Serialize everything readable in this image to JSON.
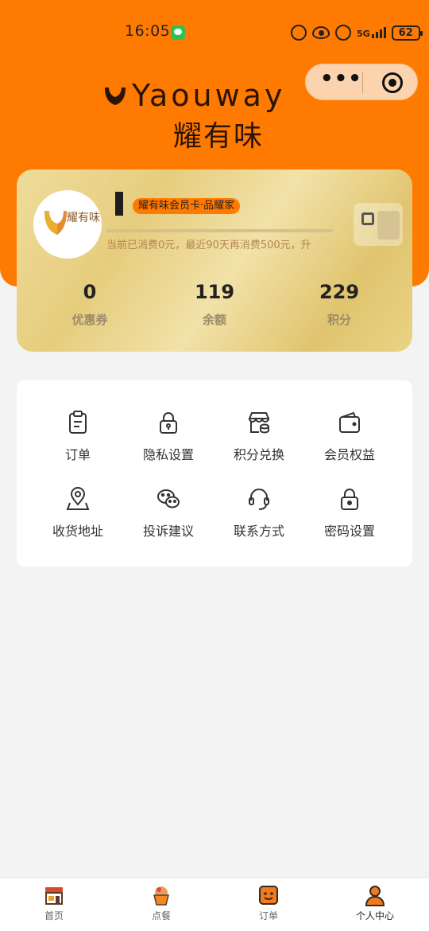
{
  "status_bar": {
    "time": "16:05",
    "network": "5G",
    "battery": "62"
  },
  "capsule": {
    "more_icon": "more-dots-icon",
    "close_icon": "target-icon"
  },
  "brand": {
    "latin_name": "Yaouway",
    "cjk_name": "耀有味"
  },
  "member_card": {
    "avatar_text": "耀有味",
    "badge": "耀有味会员卡·品耀家",
    "progress_fraction": 0.0,
    "progress_text": "当前已消费0元，最近90天再消费500元，升",
    "stats": [
      {
        "value": "0",
        "label": "优惠券"
      },
      {
        "value": "119",
        "label": "余额"
      },
      {
        "value": "229",
        "label": "积分"
      }
    ]
  },
  "menu": {
    "items": [
      {
        "label": "订单",
        "icon": "clipboard-icon"
      },
      {
        "label": "隐私设置",
        "icon": "lock-icon"
      },
      {
        "label": "积分兑换",
        "icon": "store-icon"
      },
      {
        "label": "会员权益",
        "icon": "wallet-icon"
      },
      {
        "label": "收货地址",
        "icon": "location-icon"
      },
      {
        "label": "投诉建议",
        "icon": "wechat-icon"
      },
      {
        "label": "联系方式",
        "icon": "headset-icon"
      },
      {
        "label": "密码设置",
        "icon": "padlock-icon"
      }
    ]
  },
  "tabbar": {
    "items": [
      {
        "label": "首页",
        "icon": "shop-icon"
      },
      {
        "label": "点餐",
        "icon": "cupcake-icon"
      },
      {
        "label": "订单",
        "icon": "order-icon"
      },
      {
        "label": "个人中心",
        "icon": "user-icon"
      }
    ],
    "active_index": 3
  },
  "colors": {
    "primary": "#ff7a00",
    "card_gold": "#e6cd7e",
    "background": "#f3f3f3"
  }
}
